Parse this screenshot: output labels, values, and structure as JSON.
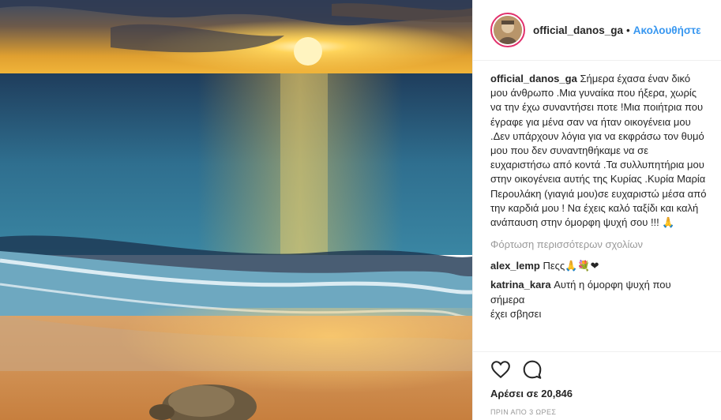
{
  "post": {
    "username": "official_danos_ga",
    "separator": "•",
    "follow_label": "Ακολουθήστε",
    "caption_user": "official_danos_ga",
    "caption_text": "Σήμερα έχασα έναν δικό μου άνθρωπο .Μια γυναίκα που ήξερα, χωρίς να την έχω συναντήσει ποτε !Μια ποιήτρια που έγραφε για μένα σαν να ήταν οικογένεια μου .Δεν υπάρχουν λόγια για να εκφράσω τον θυμό μου που δεν συναντηθήκαμε να σε ευχαριστήσω από κοντά .Τα συλλυπητήρια μου στην οικογένεια αυτής της Κυρίας .Κυρία Μαρία Περουλάκη (γιαγιά μου)σε ευχαριστώ μέσα από την καρδιά μου ! Να έχεις καλό ταξίδι και καλή ανάπαυση στην όμορφη ψυχή σου !!! 🙏",
    "load_more_label": "Φόρτωση περισσότερων σχολίων",
    "comments": [
      {
        "user": "alex_lemp",
        "text": "Πεςς🙏💐❤"
      },
      {
        "user": "katrina_kara",
        "text": "Αυτή η όμορφη ψυχή που σήμερα\nέχει σβησει"
      }
    ],
    "likes_label": "Αρέσει σε 20,846",
    "time_label": "ΠΡΙΝ ΑΠΟ 3 ΩΡΕΣ",
    "icons": {
      "like": "heart-icon",
      "comment": "comment-bubble-icon"
    }
  }
}
